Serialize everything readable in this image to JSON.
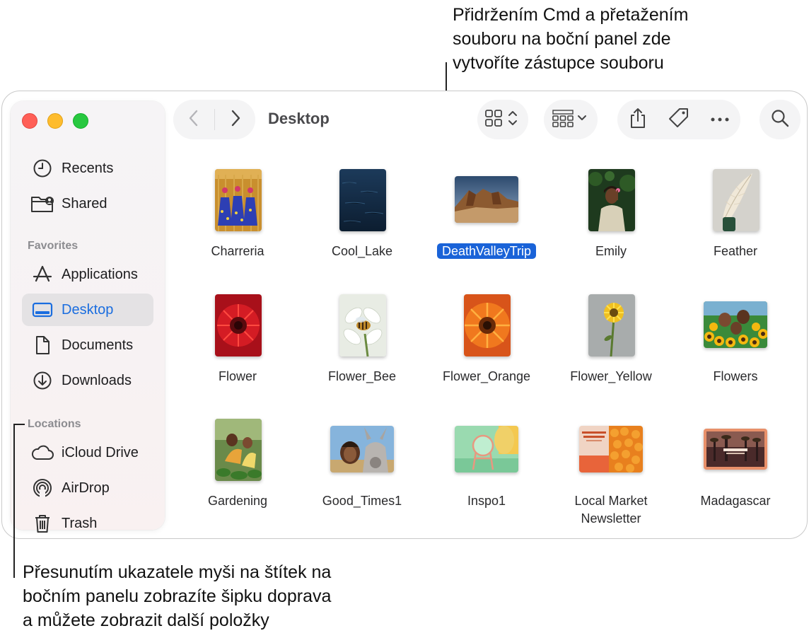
{
  "callouts": {
    "top_lines": [
      "Přidržením Cmd a přetažením",
      "souboru na boční panel zde",
      "vytvoříte zástupce souboru"
    ],
    "bottom_lines": [
      "Přesunutím ukazatele myši na štítek na",
      "bočním panelu zobrazíte šipku doprava",
      "a můžete zobrazit další položky"
    ]
  },
  "window": {
    "title": "Desktop"
  },
  "sidebar": {
    "top_items": [
      {
        "label": "Recents",
        "icon": "clock-icon"
      },
      {
        "label": "Shared",
        "icon": "shared-folder-icon"
      }
    ],
    "favorites_header": "Favorites",
    "favorites": [
      {
        "label": "Applications",
        "icon": "applications-icon"
      },
      {
        "label": "Desktop",
        "icon": "desktop-icon",
        "selected": true
      },
      {
        "label": "Documents",
        "icon": "document-icon"
      },
      {
        "label": "Downloads",
        "icon": "download-icon"
      }
    ],
    "locations_header": "Locations",
    "locations": [
      {
        "label": "iCloud Drive",
        "icon": "cloud-icon"
      },
      {
        "label": "AirDrop",
        "icon": "airdrop-icon"
      },
      {
        "label": "Trash",
        "icon": "trash-icon"
      }
    ]
  },
  "files": [
    {
      "name": "Charreria"
    },
    {
      "name": "Cool_Lake"
    },
    {
      "name": "DeathValleyTrip",
      "selected": true
    },
    {
      "name": "Emily"
    },
    {
      "name": "Feather"
    },
    {
      "name": "Flower"
    },
    {
      "name": "Flower_Bee"
    },
    {
      "name": "Flower_Orange"
    },
    {
      "name": "Flower_Yellow"
    },
    {
      "name": "Flowers"
    },
    {
      "name": "Gardening"
    },
    {
      "name": "Good_Times1"
    },
    {
      "name": "Inspo1"
    },
    {
      "name": "Local Market Newsletter",
      "name_lines": [
        "Local Market",
        "Newsletter"
      ]
    },
    {
      "name": "Madagascar"
    }
  ],
  "colors": {
    "accent": "#1a63d8",
    "traffic_red": "#ff5f57",
    "traffic_yellow": "#febc2e",
    "traffic_green": "#28c840"
  }
}
